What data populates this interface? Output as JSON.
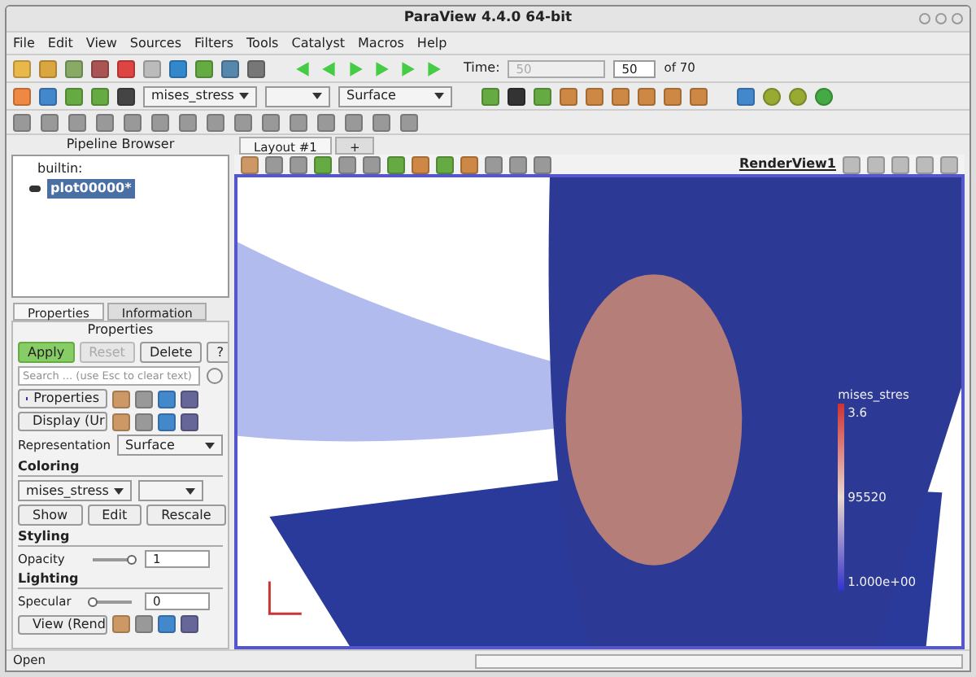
{
  "window": {
    "title": "ParaView 4.4.0 64-bit"
  },
  "menu": [
    "File",
    "Edit",
    "View",
    "Sources",
    "Filters",
    "Tools",
    "Catalyst",
    "Macros",
    "Help"
  ],
  "time": {
    "label": "Time:",
    "field_value": "50",
    "spin_value": "50",
    "total": "of 70"
  },
  "toolbar2": {
    "array_select": "mises_stress",
    "representation_select": "Surface"
  },
  "pipeline_browser": {
    "title": "Pipeline Browser",
    "items": [
      {
        "label": "builtin:",
        "selected": false,
        "children": [
          {
            "label": "plot00000*",
            "selected": true,
            "visible": true
          }
        ]
      }
    ]
  },
  "panel_tabs": [
    {
      "label": "Properties",
      "selected": true
    },
    {
      "label": "Information",
      "selected": false
    }
  ],
  "properties": {
    "title": "Properties",
    "buttons": [
      {
        "kind": "apply",
        "label": "Apply",
        "disabled": false
      },
      {
        "kind": "reset",
        "label": "Reset",
        "disabled": true
      },
      {
        "kind": "delete",
        "label": "Delete",
        "disabled": false
      },
      {
        "kind": "help",
        "label": "?",
        "disabled": false
      }
    ],
    "search": {
      "placeholder": "Search ... (use Esc to clear text)"
    },
    "rows": [
      {
        "kind": "section_button",
        "label": "Properties"
      },
      {
        "kind": "section_button",
        "label": "Display (Ur"
      },
      {
        "kind": "select",
        "label": "Representation",
        "value": "Surface"
      },
      {
        "kind": "heading",
        "label": "Coloring"
      },
      {
        "kind": "color_select",
        "value": "mises_stress"
      },
      {
        "kind": "buttons",
        "items": [
          "Show",
          "Edit",
          "Rescale"
        ]
      },
      {
        "kind": "heading",
        "label": "Styling"
      },
      {
        "kind": "slider",
        "label": "Opacity",
        "level": 1,
        "value": "1"
      },
      {
        "kind": "heading",
        "label": "Lighting"
      },
      {
        "kind": "slider",
        "label": "Specular",
        "level": 0,
        "value": "0"
      },
      {
        "kind": "section_button",
        "label": "View (Rend"
      }
    ]
  },
  "layout_tabs": [
    {
      "label": "Layout #1",
      "selected": true
    },
    {
      "label": "+",
      "selected": false
    }
  ],
  "render_view": {
    "title": "RenderView1",
    "legend": {
      "title": "mises_stres",
      "labels": [
        "3.6",
        "95520",
        "1.000e+00"
      ]
    }
  },
  "status_bar": {
    "text": "Open"
  }
}
